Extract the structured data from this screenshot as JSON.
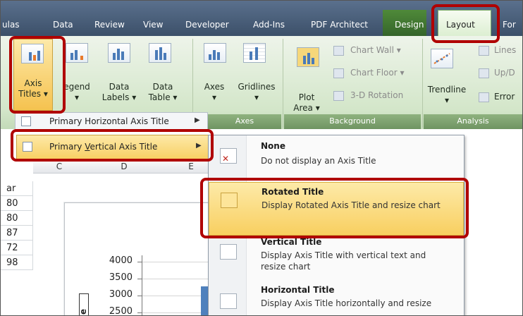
{
  "tabs": [
    "ulas",
    "Data",
    "Review",
    "View",
    "Developer",
    "Add-Ins",
    "PDF Architect"
  ],
  "design_tab": "Design",
  "layout_tab": "Layout",
  "for_tab": "For",
  "ribbon": {
    "axis_titles": [
      "Axis",
      "Titles"
    ],
    "legend": "egend",
    "data_labels": [
      "Data",
      "Labels"
    ],
    "data_table": [
      "Data",
      "Table"
    ],
    "axes": "Axes",
    "gridlines": "Gridlines",
    "plot_area": [
      "Plot",
      "Area"
    ],
    "chart_wall": "Chart Wall",
    "chart_floor": "Chart Floor",
    "rotation_3d": "3-D Rotation",
    "trendline": "Trendline",
    "lines": "Lines",
    "updown": "Up/D",
    "error": "Error",
    "groups": {
      "axes": "Axes",
      "background": "Background",
      "analysis": "Analysis"
    }
  },
  "menu": {
    "horizontal": "Primary Horizontal Axis Title",
    "vertical_pre": "Primary ",
    "vertical_accel": "V",
    "vertical_post": "ertical Axis Title"
  },
  "sheet": {
    "cols": [
      "C",
      "D",
      "E"
    ],
    "rows": [
      "ar",
      "80",
      "80",
      "87",
      "72",
      "98"
    ],
    "chart_yticks": [
      "4000",
      "3500",
      "3000",
      "2500"
    ]
  },
  "dropdown": {
    "items": [
      {
        "title": "None",
        "desc": "Do not display an Axis Title"
      },
      {
        "title": "Rotated Title",
        "desc": "Display Rotated Axis Title and resize chart"
      },
      {
        "title": "Vertical Title",
        "desc": "Display Axis Title with vertical text and resize chart"
      },
      {
        "title": "Horizontal Title",
        "desc": "Display Axis Title horizontally and resize"
      }
    ]
  },
  "colors": {
    "highlight": "#f8cf62",
    "annotation": "#b00000",
    "layout_tab": "#dbeed0"
  }
}
